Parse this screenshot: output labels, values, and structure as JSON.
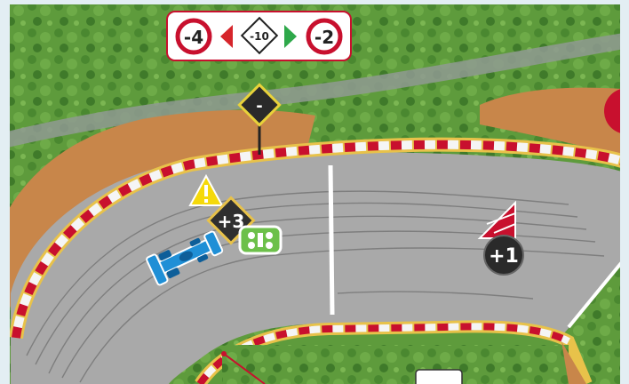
{
  "hud": {
    "left_value": "-4",
    "center_value": "-10",
    "right_value": "-2",
    "left_color": "#d6252b",
    "right_color": "#2ea84a"
  },
  "tokens": {
    "corner_sign": "-",
    "boost_chip": "+3",
    "bonus_chip": "+1"
  },
  "colors": {
    "track": "#a9a9a9",
    "grass": "#5e9b3c",
    "sand": "#c8864a",
    "kerb_red": "#c8102e",
    "kerb_white": "#f5f5f5",
    "car_blue": "#1f8fd6",
    "car_green": "#6cc04a",
    "warning_yellow": "#f5d90a"
  }
}
